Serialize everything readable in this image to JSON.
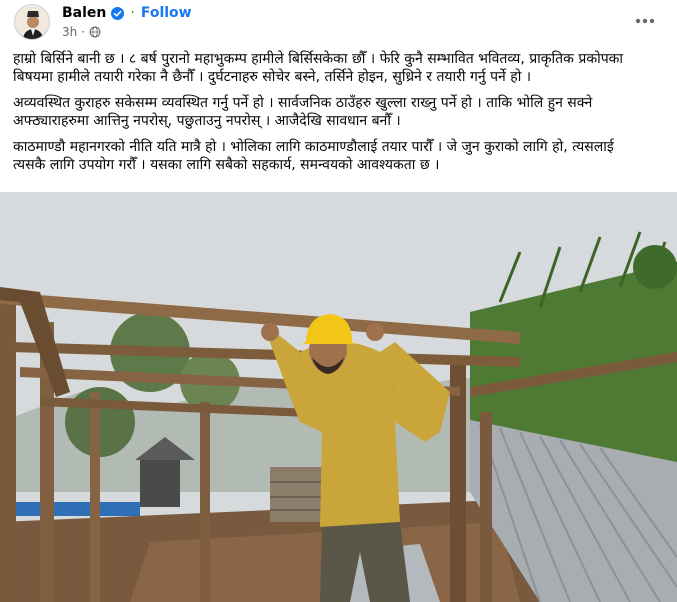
{
  "post": {
    "author": "Balen",
    "follow_label": "Follow",
    "time": "3h",
    "paragraphs": [
      [
        "हाम्रो बिर्सिने बानी छ । ८ बर्ष पुरानो महाभुकम्प हामीले बिर्सिसकेका छौँ । फेरि कुनै सम्भावित भवितव्य, प्राकृतिक प्रकोपका",
        "बिषयमा हामीले तयारी गरेका नै छैनौँ । दुर्घटनाहरु सोचेर बस्ने, तर्सिने होइन, सुध्रिने र तयारी गर्नु पर्ने हो ।"
      ],
      [
        "अव्यवस्थित कुराहरु सकेसम्म व्यवस्थित गर्नु पर्ने हो । सार्वजनिक ठाउँहरु खुल्ला राख्नु पर्ने हो । ताकि भोलि हुन सक्ने",
        "अफ्ठ्याराहरुमा आत्तिनु नपरोस्, पछुताउनु नपरोस् । आजैदेखि सावधान बनौँ ।"
      ],
      [
        "काठमाण्डौ महानगरको नीति यति मात्रै हो । भोलिका लागि काठमाण्डौलाई तयार पारौँ । जे जुन कुराको लागि हो, त्यसलाई",
        "त्यसकै लागि उपयोग गरौँ । यसका लागि सबैको सहकार्य, समन्वयको आवश्यकता छ ।"
      ]
    ]
  },
  "icons": {
    "verified": "verified-badge-icon",
    "privacy": "globe-icon",
    "more": "more-options-icon"
  },
  "colors": {
    "brand_blue": "#1877f2",
    "secondary_text": "#65676b",
    "helmet_yellow": "#f2c616",
    "shirt_yellow": "#c9a53a"
  }
}
